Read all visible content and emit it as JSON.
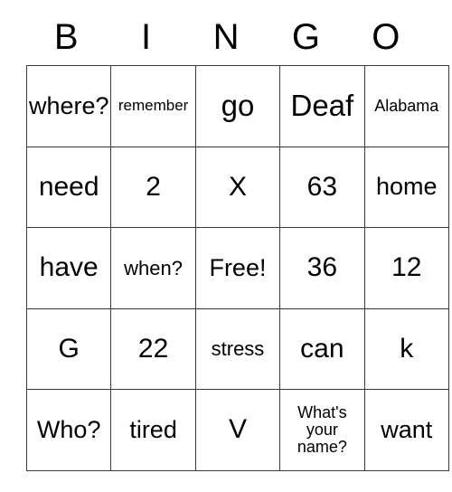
{
  "card": {
    "header": {
      "letters": [
        "B",
        "I",
        "N",
        "G",
        "O"
      ]
    },
    "grid": {
      "rows": [
        [
          {
            "text": "where?",
            "size": "fs-md"
          },
          {
            "text": "remember",
            "size": "fs-xxs"
          },
          {
            "text": "go",
            "size": "fs-xl"
          },
          {
            "text": "Deaf",
            "size": "fs-xl"
          },
          {
            "text": "Alabama",
            "size": "fs-xs"
          }
        ],
        [
          {
            "text": "need",
            "size": "fs-lg"
          },
          {
            "text": "2",
            "size": "fs-lg"
          },
          {
            "text": "X",
            "size": "fs-lg"
          },
          {
            "text": "63",
            "size": "fs-lg"
          },
          {
            "text": "home",
            "size": "fs-md"
          }
        ],
        [
          {
            "text": "have",
            "size": "fs-lg"
          },
          {
            "text": "when?",
            "size": "fs-sm"
          },
          {
            "text": "Free!",
            "size": "fs-md"
          },
          {
            "text": "36",
            "size": "fs-lg"
          },
          {
            "text": "12",
            "size": "fs-lg"
          }
        ],
        [
          {
            "text": "G",
            "size": "fs-lg"
          },
          {
            "text": "22",
            "size": "fs-lg"
          },
          {
            "text": "stress",
            "size": "fs-sm"
          },
          {
            "text": "can",
            "size": "fs-lg"
          },
          {
            "text": "k",
            "size": "fs-lg"
          }
        ],
        [
          {
            "text": "Who?",
            "size": "fs-md"
          },
          {
            "text": "tired",
            "size": "fs-md"
          },
          {
            "text": "V",
            "size": "fs-lg"
          },
          {
            "text": "What's\nyour\nname?",
            "size": "fs-xs"
          },
          {
            "text": "want",
            "size": "fs-md"
          }
        ]
      ]
    },
    "colors": {
      "background": "#ffffff",
      "border": "#3a3a3a",
      "text": "#000000"
    }
  }
}
